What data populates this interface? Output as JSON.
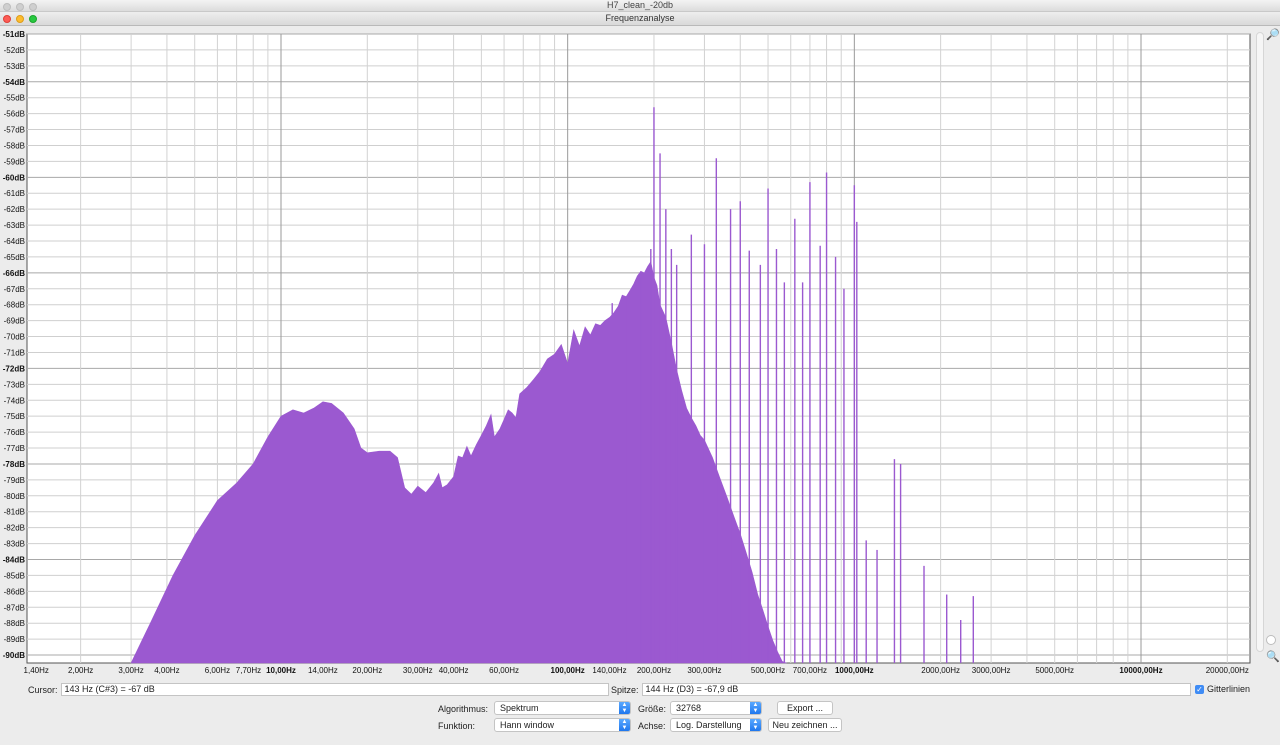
{
  "window": {
    "title": "H7_clean_-20db",
    "dialog_title": "Frequenzanalyse"
  },
  "chart_data": {
    "type": "area",
    "title": "",
    "xlabel": "",
    "ylabel": "",
    "x_scale": "log",
    "xlim": [
      1.3,
      24000
    ],
    "ylim": [
      -90.5,
      -51
    ],
    "fill_color": "#9b59d0",
    "grid": true,
    "y_ticks": [
      "-51dB",
      "-52dB",
      "-53dB",
      "-54dB",
      "-55dB",
      "-56dB",
      "-57dB",
      "-58dB",
      "-59dB",
      "-60dB",
      "-61dB",
      "-62dB",
      "-63dB",
      "-64dB",
      "-65dB",
      "-66dB",
      "-67dB",
      "-68dB",
      "-69dB",
      "-70dB",
      "-71dB",
      "-72dB",
      "-73dB",
      "-74dB",
      "-75dB",
      "-76dB",
      "-77dB",
      "-78dB",
      "-79dB",
      "-80dB",
      "-81dB",
      "-82dB",
      "-83dB",
      "-84dB",
      "-85dB",
      "-86dB",
      "-87dB",
      "-88dB",
      "-89dB",
      "-90dB"
    ],
    "y_ticks_bold": [
      "-51dB",
      "-54dB",
      "-60dB",
      "-66dB",
      "-72dB",
      "-78dB",
      "-84dB",
      "-90dB"
    ],
    "x_ticks": [
      {
        "v": 1.4,
        "label": "1,40Hz"
      },
      {
        "v": 2,
        "label": "2,00Hz"
      },
      {
        "v": 3,
        "label": "3,00Hz"
      },
      {
        "v": 4,
        "label": "4,00Hz"
      },
      {
        "v": 6,
        "label": "6,00Hz"
      },
      {
        "v": 7.7,
        "label": "7,70Hz"
      },
      {
        "v": 10,
        "label": "10,00Hz",
        "bold": true
      },
      {
        "v": 14,
        "label": "14,00Hz"
      },
      {
        "v": 20,
        "label": "20,00Hz"
      },
      {
        "v": 30,
        "label": "30,00Hz"
      },
      {
        "v": 40,
        "label": "40,00Hz"
      },
      {
        "v": 60,
        "label": "60,00Hz"
      },
      {
        "v": 100,
        "label": "100,00Hz",
        "bold": true
      },
      {
        "v": 140,
        "label": "140,00Hz"
      },
      {
        "v": 200,
        "label": "200,00Hz"
      },
      {
        "v": 300,
        "label": "300,00Hz"
      },
      {
        "v": 500,
        "label": "500,00Hz"
      },
      {
        "v": 700,
        "label": "700,00Hz"
      },
      {
        "v": 1000,
        "label": "1000,00Hz",
        "bold": true
      },
      {
        "v": 2000,
        "label": "2000,00Hz"
      },
      {
        "v": 3000,
        "label": "3000,00Hz"
      },
      {
        "v": 5000,
        "label": "5000,00Hz"
      },
      {
        "v": 10000,
        "label": "10000,00Hz",
        "bold": true
      },
      {
        "v": 20000,
        "label": "20000,00Hz"
      }
    ],
    "spectrum": [
      [
        3.0,
        -91
      ],
      [
        3.5,
        -88
      ],
      [
        4.2,
        -85
      ],
      [
        5.0,
        -82.5
      ],
      [
        6.0,
        -80.3
      ],
      [
        7.0,
        -79.2
      ],
      [
        8.0,
        -78
      ],
      [
        9.0,
        -76.3
      ],
      [
        10.0,
        -75
      ],
      [
        11.0,
        -74.6
      ],
      [
        12.0,
        -74.8
      ],
      [
        13.0,
        -74.5
      ],
      [
        14.0,
        -74.1
      ],
      [
        15.0,
        -74.2
      ],
      [
        16.5,
        -74.8
      ],
      [
        18.0,
        -75.8
      ],
      [
        19.0,
        -77
      ],
      [
        20.0,
        -77.3
      ],
      [
        22.0,
        -77.2
      ],
      [
        24.0,
        -77.2
      ],
      [
        25.5,
        -77.6
      ],
      [
        27.0,
        -79.5
      ],
      [
        28.5,
        -79.9
      ],
      [
        30.0,
        -79.4
      ],
      [
        32.0,
        -79.8
      ],
      [
        34.0,
        -79.2
      ],
      [
        35.5,
        -78.6
      ],
      [
        36.5,
        -79.5
      ],
      [
        38.0,
        -79.3
      ],
      [
        40.0,
        -78.8
      ],
      [
        41.5,
        -77.5
      ],
      [
        43.0,
        -77.6
      ],
      [
        44.5,
        -76.9
      ],
      [
        46.0,
        -77.5
      ],
      [
        48.0,
        -76.8
      ],
      [
        50.0,
        -76.2
      ],
      [
        52.0,
        -75.6
      ],
      [
        54.0,
        -74.9
      ],
      [
        55.5,
        -76.3
      ],
      [
        58.0,
        -75.8
      ],
      [
        60.0,
        -75.2
      ],
      [
        62.0,
        -74.6
      ],
      [
        64.0,
        -74.8
      ],
      [
        66.0,
        -75.1
      ],
      [
        68.0,
        -73.6
      ],
      [
        72.0,
        -73.2
      ],
      [
        76.0,
        -72.7
      ],
      [
        80.0,
        -72.2
      ],
      [
        85.0,
        -71.4
      ],
      [
        90.0,
        -71.1
      ],
      [
        95.0,
        -70.5
      ],
      [
        100.0,
        -71.7
      ],
      [
        105.0,
        -69.6
      ],
      [
        110.0,
        -70.6
      ],
      [
        115.0,
        -69.4
      ],
      [
        120.0,
        -69.9
      ],
      [
        125.0,
        -69.2
      ],
      [
        130.0,
        -69.3
      ],
      [
        135.0,
        -69.0
      ],
      [
        140.0,
        -68.8
      ],
      [
        145.0,
        -68.5
      ],
      [
        150.0,
        -68.1
      ],
      [
        155.0,
        -67.4
      ],
      [
        160.0,
        -67.5
      ],
      [
        165.0,
        -67.1
      ],
      [
        170.0,
        -66.7
      ],
      [
        175.0,
        -66.2
      ],
      [
        180.0,
        -65.9
      ],
      [
        185.0,
        -66.0
      ],
      [
        190.0,
        -65.6
      ],
      [
        195.0,
        -65.3
      ],
      [
        200.0,
        -66.3
      ],
      [
        205.0,
        -66.8
      ],
      [
        210.0,
        -68.0
      ],
      [
        220.0,
        -68.8
      ],
      [
        230.0,
        -70.4
      ],
      [
        240.0,
        -72.1
      ],
      [
        250.0,
        -73.4
      ],
      [
        260.0,
        -74.5
      ],
      [
        270.0,
        -75.1
      ],
      [
        280.0,
        -75.6
      ],
      [
        290.0,
        -76.2
      ],
      [
        300.0,
        -76.5
      ],
      [
        320.0,
        -77.6
      ],
      [
        340.0,
        -78.9
      ],
      [
        360.0,
        -80.1
      ],
      [
        380.0,
        -81.3
      ],
      [
        400.0,
        -82.4
      ],
      [
        420.0,
        -83.6
      ],
      [
        440.0,
        -84.8
      ],
      [
        460.0,
        -86.2
      ],
      [
        480.0,
        -87.2
      ],
      [
        500.0,
        -88.2
      ],
      [
        520.0,
        -89.1
      ],
      [
        540.0,
        -89.8
      ],
      [
        560.0,
        -90.4
      ],
      [
        580.0,
        -91
      ]
    ],
    "peaks": [
      [
        143,
        -67.9
      ],
      [
        160,
        -67.5
      ],
      [
        180,
        -66.3
      ],
      [
        195,
        -64.5
      ],
      [
        200,
        -55.6
      ],
      [
        210,
        -58.5
      ],
      [
        220,
        -62.0
      ],
      [
        230,
        -64.5
      ],
      [
        240,
        -65.5
      ],
      [
        270,
        -63.6
      ],
      [
        300,
        -64.2
      ],
      [
        330,
        -58.8
      ],
      [
        370,
        -62.0
      ],
      [
        400,
        -61.5
      ],
      [
        430,
        -64.6
      ],
      [
        470,
        -65.5
      ],
      [
        500,
        -60.7
      ],
      [
        535,
        -64.5
      ],
      [
        570,
        -66.6
      ],
      [
        620,
        -62.6
      ],
      [
        660,
        -66.6
      ],
      [
        700,
        -60.3
      ],
      [
        760,
        -64.3
      ],
      [
        800,
        -59.7
      ],
      [
        860,
        -65.0
      ],
      [
        920,
        -67.0
      ],
      [
        1000,
        -60.5
      ],
      [
        1020,
        -62.8
      ],
      [
        1100,
        -82.8
      ],
      [
        1200,
        -83.4
      ],
      [
        1380,
        -77.7
      ],
      [
        1450,
        -78.0
      ],
      [
        1750,
        -84.4
      ],
      [
        2100,
        -86.2
      ],
      [
        2350,
        -87.8
      ],
      [
        2600,
        -86.3
      ]
    ]
  },
  "controls": {
    "cursor_label": "Cursor:",
    "cursor_value": "143 Hz (C#3) = -67 dB",
    "peak_label": "Spitze:",
    "peak_value": "144 Hz (D3) = -67,9 dB",
    "grid_label": "Gitterlinien",
    "grid_checked": true,
    "algorithm_label": "Algorithmus:",
    "algorithm_value": "Spektrum",
    "function_label": "Funktion:",
    "function_value": "Hann window",
    "size_label": "Größe:",
    "size_value": "32768",
    "axis_label": "Achse:",
    "axis_value": "Log. Darstellung",
    "export_label": "Export ...",
    "redraw_label": "Neu zeichnen ..."
  }
}
